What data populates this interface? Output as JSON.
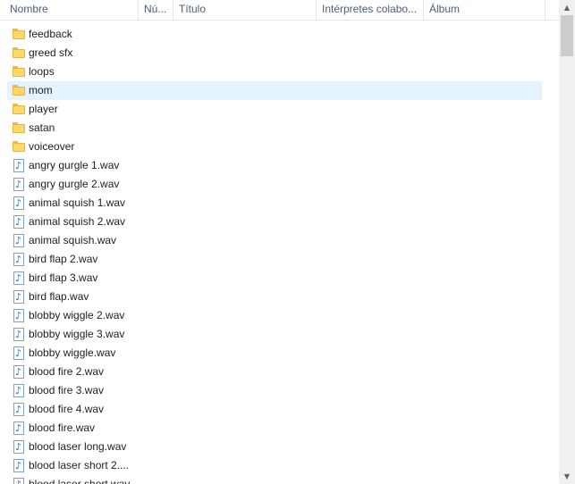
{
  "columns": {
    "name": "Nombre",
    "number": "Nú...",
    "title": "Título",
    "artists": "Intérpretes colabo...",
    "album": "Álbum"
  },
  "items": [
    {
      "type": "folder",
      "name": "feedback"
    },
    {
      "type": "folder",
      "name": "greed sfx"
    },
    {
      "type": "folder",
      "name": "loops"
    },
    {
      "type": "folder",
      "name": "mom",
      "hover": true
    },
    {
      "type": "folder",
      "name": "player"
    },
    {
      "type": "folder",
      "name": "satan"
    },
    {
      "type": "folder",
      "name": "voiceover"
    },
    {
      "type": "audio",
      "name": "angry gurgle 1.wav"
    },
    {
      "type": "audio",
      "name": "angry gurgle 2.wav"
    },
    {
      "type": "audio",
      "name": "animal squish 1.wav"
    },
    {
      "type": "audio",
      "name": "animal squish 2.wav"
    },
    {
      "type": "audio",
      "name": "animal squish.wav"
    },
    {
      "type": "audio",
      "name": "bird flap 2.wav"
    },
    {
      "type": "audio",
      "name": "bird flap 3.wav"
    },
    {
      "type": "audio",
      "name": "bird flap.wav"
    },
    {
      "type": "audio",
      "name": "blobby wiggle 2.wav"
    },
    {
      "type": "audio",
      "name": "blobby wiggle 3.wav"
    },
    {
      "type": "audio",
      "name": "blobby wiggle.wav"
    },
    {
      "type": "audio",
      "name": "blood fire 2.wav"
    },
    {
      "type": "audio",
      "name": "blood fire 3.wav"
    },
    {
      "type": "audio",
      "name": "blood fire 4.wav"
    },
    {
      "type": "audio",
      "name": "blood fire.wav"
    },
    {
      "type": "audio",
      "name": "blood laser long.wav"
    },
    {
      "type": "audio",
      "name": "blood laser short 2...."
    },
    {
      "type": "audio",
      "name": "blood laser short.wav"
    }
  ],
  "icons": {
    "folder": "folder-icon",
    "audio": "audio-file-icon",
    "scroll_up": "chevron-up-icon",
    "scroll_down": "chevron-down-icon"
  },
  "colors": {
    "hover_row": "#e5f3ff",
    "header_text": "#4c607a",
    "folder": "#ffd866",
    "note": "#2a6fd1"
  }
}
